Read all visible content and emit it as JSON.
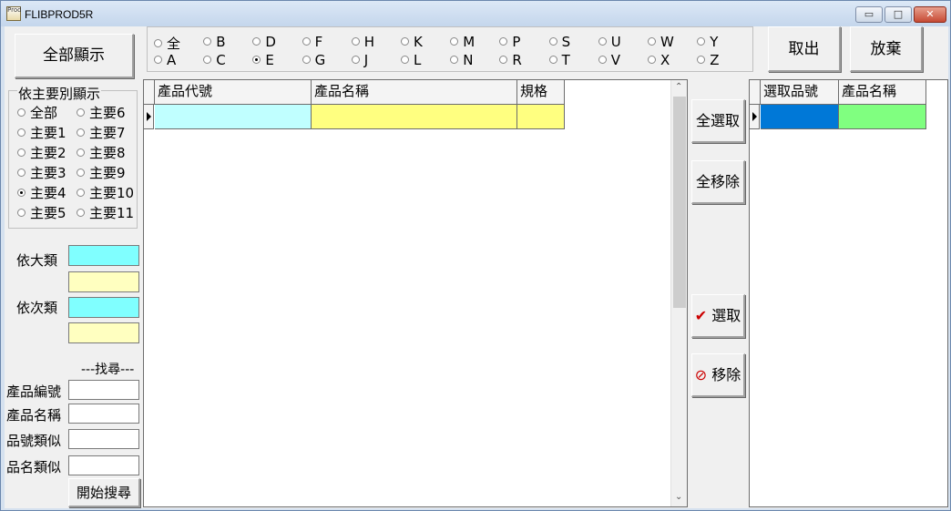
{
  "window": {
    "title": "FLIBPROD5R",
    "app_icon_text": "Prod"
  },
  "toolbar": {
    "show_all_label": "全部顯示",
    "take_label": "取出",
    "abandon_label": "放棄"
  },
  "letter_filter": {
    "row1": [
      "全",
      "B",
      "D",
      "F",
      "H",
      "K",
      "M",
      "P",
      "S",
      "U",
      "W",
      "Y"
    ],
    "row2": [
      "A",
      "C",
      "E",
      "G",
      "J",
      "L",
      "N",
      "R",
      "T",
      "V",
      "X",
      "Z"
    ],
    "selected": "E"
  },
  "primary_filter": {
    "legend": "依主要別顯示",
    "options": [
      "全部",
      "主要6",
      "主要1",
      "主要7",
      "主要2",
      "主要8",
      "主要3",
      "主要9",
      "主要4",
      "主要10",
      "主要5",
      "主要11"
    ],
    "selected": "主要4"
  },
  "category": {
    "major_label": "依大類",
    "minor_label": "依次類",
    "colors": {
      "cyan": "#80ffff",
      "yellow": "#ffffc0"
    }
  },
  "search": {
    "header": "---找尋---",
    "product_code_label": "產品編號",
    "product_name_label": "產品名稱",
    "code_like_label": "品號類似",
    "name_like_label": "品名類似",
    "start_button": "開始搜尋"
  },
  "product_grid": {
    "columns": [
      "產品代號",
      "產品名稱",
      "規格"
    ],
    "colors": {
      "code": "#c0ffff",
      "name": "#ffff80"
    }
  },
  "actions": {
    "select_all": "全選取",
    "remove_all": "全移除",
    "select": "選取",
    "remove": "移除"
  },
  "selected_grid": {
    "columns": [
      "選取品號",
      "產品名稱"
    ],
    "colors": {
      "code": "#0078d7",
      "name": "#80ff80"
    }
  }
}
